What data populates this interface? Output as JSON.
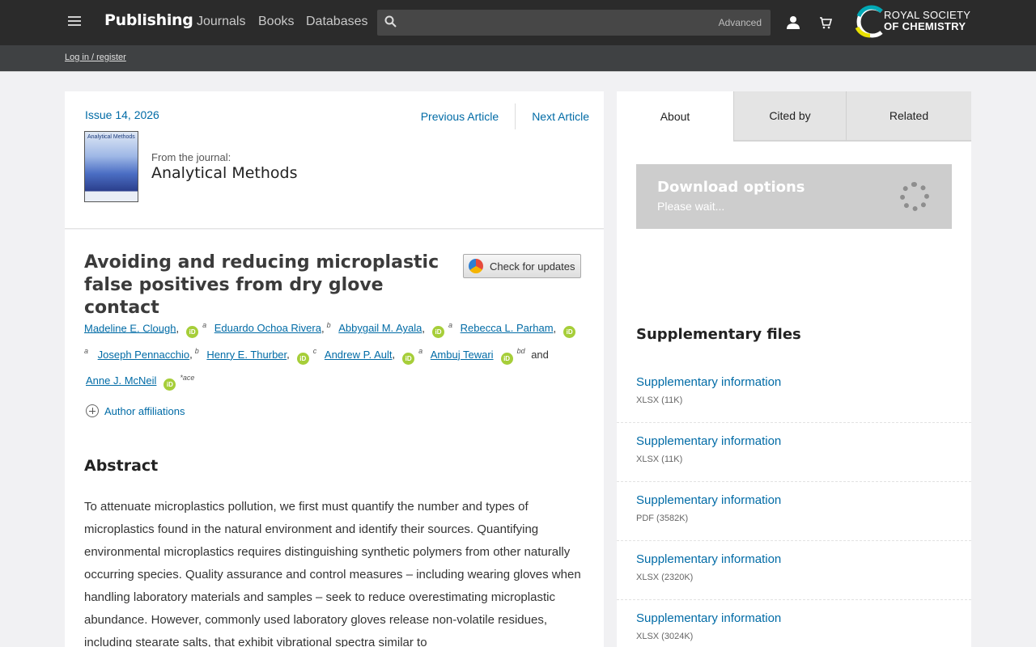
{
  "header": {
    "brand": "Publishing",
    "nav": [
      "Journals",
      "Books",
      "Databases"
    ],
    "search_placeholder": "",
    "advanced_label": "Advanced",
    "logo_line1": "ROYAL SOCIETY",
    "logo_line2": "OF CHEMISTRY"
  },
  "subbar": {
    "login_label": "Log in / register"
  },
  "article_nav": {
    "issue": "Issue 14, 2026",
    "previous": "Previous Article",
    "next": "Next Article"
  },
  "journal": {
    "from_label": "From the journal:",
    "name": "Analytical Methods",
    "cover_text": "Analytical Methods"
  },
  "article": {
    "title": "Avoiding and reducing microplastic false positives from dry glove contact",
    "check_updates": "Check for updates",
    "authors": [
      {
        "name": "Madeline E. Clough",
        "sup": "a"
      },
      {
        "name": "Eduardo Ochoa Rivera",
        "sup": "b"
      },
      {
        "name": "Abbygail M. Ayala",
        "sup": "a"
      },
      {
        "name": "Rebecca L. Parham",
        "sup": "a"
      },
      {
        "name": "Joseph Pennacchio",
        "sup": "b"
      },
      {
        "name": "Henry E. Thurber",
        "sup": "c"
      },
      {
        "name": "Andrew P. Ault",
        "sup": "a"
      },
      {
        "name": "Ambuj Tewari",
        "sup": "bd"
      },
      {
        "name": "Anne J. McNeil",
        "sup": "*ace"
      }
    ],
    "and_text": "and",
    "affiliations_label": "Author affiliations",
    "abstract_heading": "Abstract",
    "abstract": "To attenuate microplastics pollution, we first must quantify the number and types of microplastics found in the natural environment and identify their sources. Quantifying environmental microplastics requires distinguishing synthetic polymers from other naturally occurring species. Quality assurance and control measures – including wearing gloves when handling laboratory materials and samples – seek to reduce overestimating microplastic abundance. However, commonly used laboratory gloves release non-volatile residues, including stearate salts, that exhibit vibrational spectra similar to"
  },
  "sidebar": {
    "tabs": [
      "About",
      "Cited by",
      "Related"
    ],
    "download_title": "Download options",
    "download_sub": "Please wait...",
    "supp_heading": "Supplementary files",
    "supp_files": [
      {
        "label": "Supplementary information",
        "meta": "XLSX (11K)"
      },
      {
        "label": "Supplementary information",
        "meta": "XLSX (11K)"
      },
      {
        "label": "Supplementary information",
        "meta": "PDF (3582K)"
      },
      {
        "label": "Supplementary information",
        "meta": "XLSX (2320K)"
      },
      {
        "label": "Supplementary information",
        "meta": "XLSX (3024K)"
      }
    ]
  },
  "colors": {
    "link": "#006ba6",
    "topbar": "#2b2b2b",
    "orcid": "#a6ce39"
  },
  "icons": [
    "menu-icon",
    "search-icon",
    "user-icon",
    "cart-icon",
    "orcid-icon",
    "plus-circle-icon",
    "spinner-icon"
  ]
}
